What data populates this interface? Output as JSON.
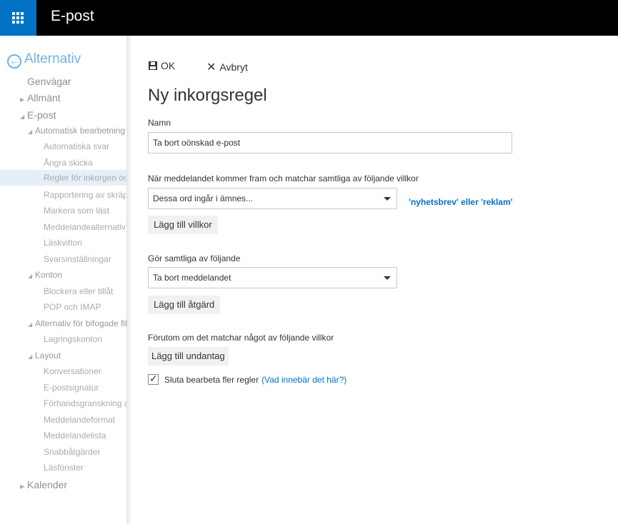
{
  "app": {
    "title": "E-post"
  },
  "sidebar": {
    "back_label": "Alternativ",
    "items": [
      {
        "label": "Genvägar",
        "level": 1
      },
      {
        "label": "Allmänt",
        "level": 1,
        "arrow": "▶"
      },
      {
        "label": "E-post",
        "level": 1,
        "arrow": "◢"
      },
      {
        "label": "Automatisk bearbetning",
        "level": 2,
        "arrow": "◢"
      },
      {
        "label": "Automatiska svar",
        "level": 3
      },
      {
        "label": "Ångra skicka",
        "level": 3
      },
      {
        "label": "Regler för inkorgen och",
        "level": 3,
        "selected": true
      },
      {
        "label": "Rapportering av skräppost",
        "level": 3
      },
      {
        "label": "Markera som läst",
        "level": 3
      },
      {
        "label": "Meddelandealternativ",
        "level": 3
      },
      {
        "label": "Läskvitton",
        "level": 3
      },
      {
        "label": "Svarsinställningar",
        "level": 3
      },
      {
        "label": "Konton",
        "level": 2,
        "arrow": "◢"
      },
      {
        "label": "Blockera eller tillåt",
        "level": 3
      },
      {
        "label": "POP och IMAP",
        "level": 3
      },
      {
        "label": "Alternativ för bifogade filer",
        "level": 2,
        "arrow": "◢"
      },
      {
        "label": "Lagringskonton",
        "level": 3
      },
      {
        "label": "Layout",
        "level": 2,
        "arrow": "◢"
      },
      {
        "label": "Konversationer",
        "level": 3
      },
      {
        "label": "E-postsignatur",
        "level": 3
      },
      {
        "label": "Förhandsgranskning av länkar",
        "level": 3
      },
      {
        "label": "Meddelandeformat",
        "level": 3
      },
      {
        "label": "Meddelandelista",
        "level": 3
      },
      {
        "label": "Snabbåtgärder",
        "level": 3
      },
      {
        "label": "Läsfönster",
        "level": 3
      },
      {
        "label": "Kalender",
        "level": 1,
        "arrow": "▶"
      }
    ]
  },
  "toolbar": {
    "ok_label": "OK",
    "cancel_label": "Avbryt"
  },
  "form": {
    "heading": "Ny inkorgsregel",
    "name_label": "Namn",
    "name_value": "Ta bort oönskad e-post",
    "condition_label": "När meddelandet kommer fram och matchar samtliga av följande villkor",
    "condition_value": "Dessa ord ingår i ämnes...",
    "condition_words": "'nyhetsbrev' eller 'reklam'",
    "add_condition": "Lägg till villkor",
    "action_label": "Gör samtliga av följande",
    "action_value": "Ta bort meddelandet",
    "add_action": "Lägg till åtgärd",
    "exception_label": "Förutom om det matchar något av följande villkor",
    "add_exception": "Lägg till undantag",
    "stop_label": "Sluta bearbeta fler regler",
    "stop_checked": true,
    "help_link": "(Vad innebär det här?)"
  },
  "colors": {
    "accent": "#0072c6",
    "topbar": "#000000",
    "button": "#f1f1f1"
  }
}
